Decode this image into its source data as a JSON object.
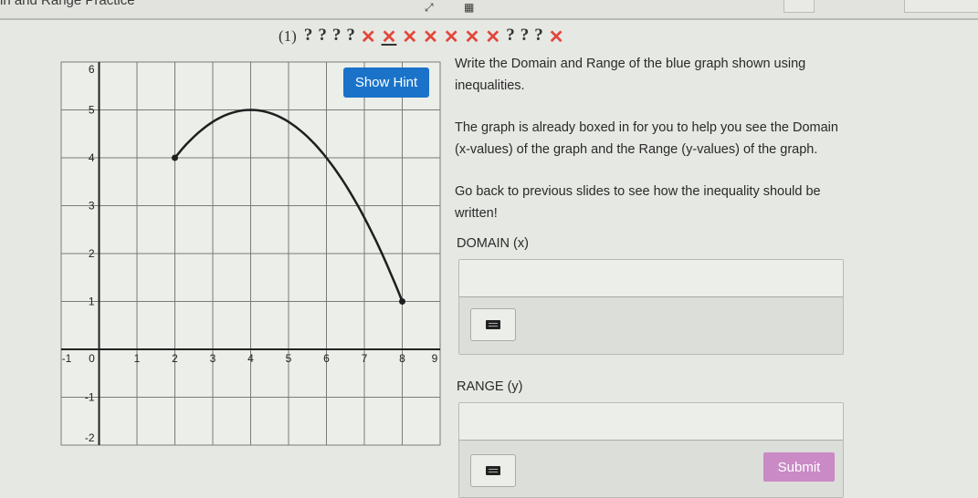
{
  "topbar": {
    "title": "in and Range Practice",
    "icons": [
      "expand-arrows-icon",
      "grid-icon"
    ]
  },
  "status": {
    "question_number": "(1)",
    "attempts": [
      {
        "state": "unanswered",
        "glyph": "?"
      },
      {
        "state": "unanswered",
        "glyph": "?"
      },
      {
        "state": "unanswered",
        "glyph": "?"
      },
      {
        "state": "unanswered",
        "glyph": "?"
      },
      {
        "state": "incorrect",
        "glyph": "✕"
      },
      {
        "state": "incorrect",
        "glyph": "✕",
        "current": true
      },
      {
        "state": "incorrect",
        "glyph": "✕"
      },
      {
        "state": "incorrect",
        "glyph": "✕"
      },
      {
        "state": "incorrect",
        "glyph": "✕"
      },
      {
        "state": "incorrect",
        "glyph": "✕"
      },
      {
        "state": "incorrect",
        "glyph": "✕"
      },
      {
        "state": "unanswered",
        "glyph": "?"
      },
      {
        "state": "unanswered",
        "glyph": "?"
      },
      {
        "state": "unanswered",
        "glyph": "?"
      },
      {
        "state": "incorrect",
        "glyph": "✕"
      }
    ]
  },
  "hint_button": "Show Hint",
  "instructions": {
    "p1": "Write the Domain and Range of the blue graph shown using inequalities.",
    "p2": "The graph is already boxed in for you to help you see the Domain (x-values) of the graph and the Range (y-values) of the graph.",
    "p3": "Go back to previous slides to see how the inequality should be written!"
  },
  "domain": {
    "label": "DOMAIN (x)",
    "value": ""
  },
  "range": {
    "label": "RANGE (y)",
    "value": ""
  },
  "submit_button": "Submit",
  "colors": {
    "hint": "#1a73c9",
    "submit": "#c98ac5",
    "incorrect": "#e2463b"
  },
  "chart_data": {
    "type": "line",
    "title": "",
    "xlabel": "",
    "ylabel": "",
    "xlim": [
      -1,
      9
    ],
    "ylim": [
      -2,
      6
    ],
    "x_ticks": [
      "-1",
      "0",
      "1",
      "2",
      "3",
      "4",
      "5",
      "6",
      "7",
      "8",
      "9"
    ],
    "y_ticks": [
      "-2",
      "-1",
      "1",
      "2",
      "3",
      "4",
      "5",
      "6"
    ],
    "grid": true,
    "series": [
      {
        "name": "graph",
        "function": "y = 5 - (x-4)^2/4",
        "x": [
          2,
          3,
          4,
          5,
          6,
          7,
          8
        ],
        "y": [
          4,
          4.75,
          5,
          4.75,
          4,
          2.75,
          1
        ],
        "endpoints": [
          {
            "x": 2,
            "y": 4,
            "closed": true
          },
          {
            "x": 8,
            "y": 1,
            "closed": true
          }
        ]
      }
    ]
  }
}
